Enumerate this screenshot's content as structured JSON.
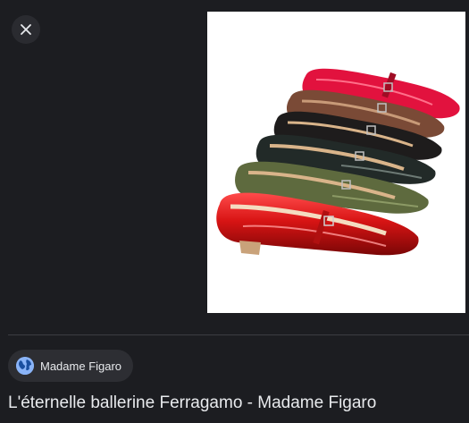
{
  "viewer": {
    "close_icon": "close-icon",
    "image_subject": "ballerina-flats-photo"
  },
  "colors": {
    "background": "#1c1d21",
    "chip": "#2d2e33",
    "globe": "#8ab4f8",
    "text": "#e8eaed",
    "shoe_colors": [
      "#e2123e",
      "#7a4a36",
      "#1e1c1c",
      "#222a28",
      "#5e6a3e",
      "#d41414"
    ]
  },
  "source": {
    "icon": "globe-icon",
    "name": "Madame Figaro"
  },
  "result": {
    "title": "L'éternelle ballerine Ferragamo - Madame Figaro"
  }
}
